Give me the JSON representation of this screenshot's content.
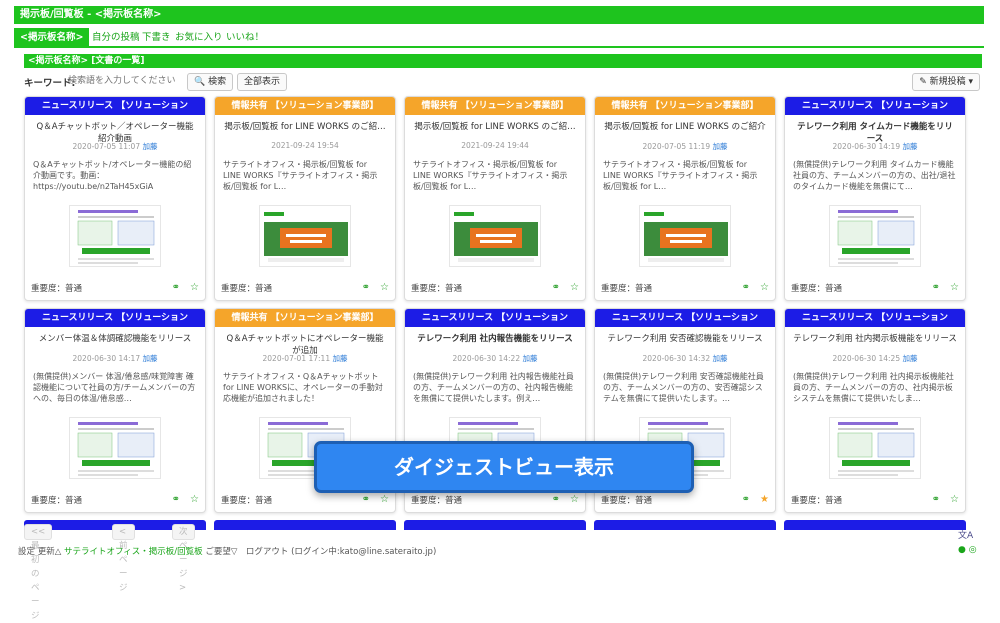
{
  "header": {
    "title": "掲示板/回覧板 - <掲示板名称>"
  },
  "nav": {
    "tabs": [
      {
        "label": "<掲示板名称>"
      },
      {
        "label": "自分の投稿"
      },
      {
        "label": "下書き"
      },
      {
        "label": "お気に入り"
      },
      {
        "label": "いいね！"
      }
    ]
  },
  "section": {
    "title": "<掲示板名称> [文書の一覧]"
  },
  "search": {
    "label": "キーワード:",
    "placeholder": "検索語を入力してください",
    "search_button": "🔍 検索",
    "all_button": "全部表示",
    "new_post_button": "✎ 新規投稿 ▾"
  },
  "cards": [
    {
      "category": "ニュースリリース 【ソリューション",
      "cat_type": "news",
      "title": "Q＆Aチャットボット／オペレーター機能 紹介動画",
      "date": "2020-07-05 11:07",
      "edit": "加藤",
      "body": "Q＆Aチャットボット/オペレーター機能の紹介動画です。動画：https://youtu.be/n2TaH45xGiA",
      "importance": "重要度：普通",
      "starred": false
    },
    {
      "category": "情報共有 【ソリューション事業部】",
      "cat_type": "info",
      "title": "掲示板/回覧板 for LINE WORKS のご紹…",
      "date": "2021-09-24 19:54",
      "edit": "",
      "body": "サテライトオフィス・掲示板/回覧板 for LINE WORKS『サテライトオフィス・掲示板/回覧板 for L…",
      "importance": "重要度：普通",
      "starred": false
    },
    {
      "category": "情報共有 【ソリューション事業部】",
      "cat_type": "info",
      "title": "掲示板/回覧板 for LINE WORKS のご紹…",
      "date": "2021-09-24 19:44",
      "edit": "",
      "body": "サテライトオフィス・掲示板/回覧板 for LINE WORKS『サテライトオフィス・掲示板/回覧板 for L…",
      "importance": "重要度：普通",
      "starred": false
    },
    {
      "category": "情報共有 【ソリューション事業部】",
      "cat_type": "info",
      "title": "掲示板/回覧板 for LINE WORKS のご紹介",
      "date": "2020-07-05 11:19",
      "edit": "加藤",
      "body": "サテライトオフィス・掲示板/回覧板 for LINE WORKS『サテライトオフィス・掲示板/回覧板 for L…",
      "importance": "重要度：普通",
      "starred": false
    },
    {
      "category": "ニュースリリース 【ソリューション",
      "cat_type": "news",
      "title": "テレワーク利用 タイムカード機能をリリース",
      "date": "2020-06-30 14:19",
      "edit": "加藤",
      "body": "(無償提供)テレワーク利用 タイムカード機能社員の方、チームメンバーの方の、出社/退社のタイムカード機能を無償にて…",
      "importance": "重要度：普通",
      "starred": false
    },
    {
      "category": "ニュースリリース 【ソリューション",
      "cat_type": "news",
      "title": "メンバー体温＆体調確認機能をリリース",
      "date": "2020-06-30 14:17",
      "edit": "加藤",
      "body": "(無償提供)メンバー 体温/倦怠感/味覚障害 確認機能について社員の方/チームメンバーの方への、毎日の体温/倦怠感…",
      "importance": "重要度：普通",
      "starred": false
    },
    {
      "category": "情報共有 【ソリューション事業部】",
      "cat_type": "info",
      "title": "Q＆Aチャットボットにオペレーター機能が追加",
      "date": "2020-07-01 17:11",
      "edit": "加藤",
      "body": "サテライトオフィス・Q＆Aチャットボット for LINE WORKSに、オペレーターの手動対応機能が追加されました！",
      "importance": "重要度：普通",
      "starred": false
    },
    {
      "category": "ニュースリリース 【ソリューション",
      "cat_type": "news",
      "title": "テレワーク利用 社内報告機能をリリース",
      "date": "2020-06-30 14:22",
      "edit": "加藤",
      "body": "(無償提供)テレワーク利用 社内報告機能社員の方、チームメンバーの方の、社内報告機能を無償にて提供いたします。例え…",
      "importance": "重要度：普通",
      "starred": false
    },
    {
      "category": "ニュースリリース 【ソリューション",
      "cat_type": "news",
      "title": "テレワーク利用 安否確認機能をリリース",
      "date": "2020-06-30 14:32",
      "edit": "加藤",
      "body": "(無償提供)テレワーク利用 安否確認機能社員の方、チームメンバーの方の、安否確認システムを無償にて提供いたします。…",
      "importance": "重要度：普通",
      "starred": true
    },
    {
      "category": "ニュースリリース 【ソリューション",
      "cat_type": "news",
      "title": "テレワーク利用 社内掲示板機能をリリース",
      "date": "2020-06-30 14:25",
      "edit": "加藤",
      "body": "(無償提供)テレワーク利用 社内掲示板機能社員の方、チームメンバーの方の、社内掲示板システムを無償にて提供いたしま…",
      "importance": "重要度：普通",
      "starred": false
    }
  ],
  "pager": {
    "first": "<< 最初のページ",
    "prev": "< 前ページ",
    "next": "次ページ >"
  },
  "footer": {
    "prefix": "設定 更新△",
    "brand": "サテライトオフィス・掲示板/回覧板",
    "rest": "ご要望▽　ログアウト (ログイン中:kato@line.sateraito.jp)"
  },
  "overlay": {
    "label": "ダイジェストビュー表示"
  },
  "colors": {
    "green": "#1ec41e",
    "news": "#1c1ce6",
    "info": "#f5a52a",
    "overlay": "#2f86f1"
  }
}
